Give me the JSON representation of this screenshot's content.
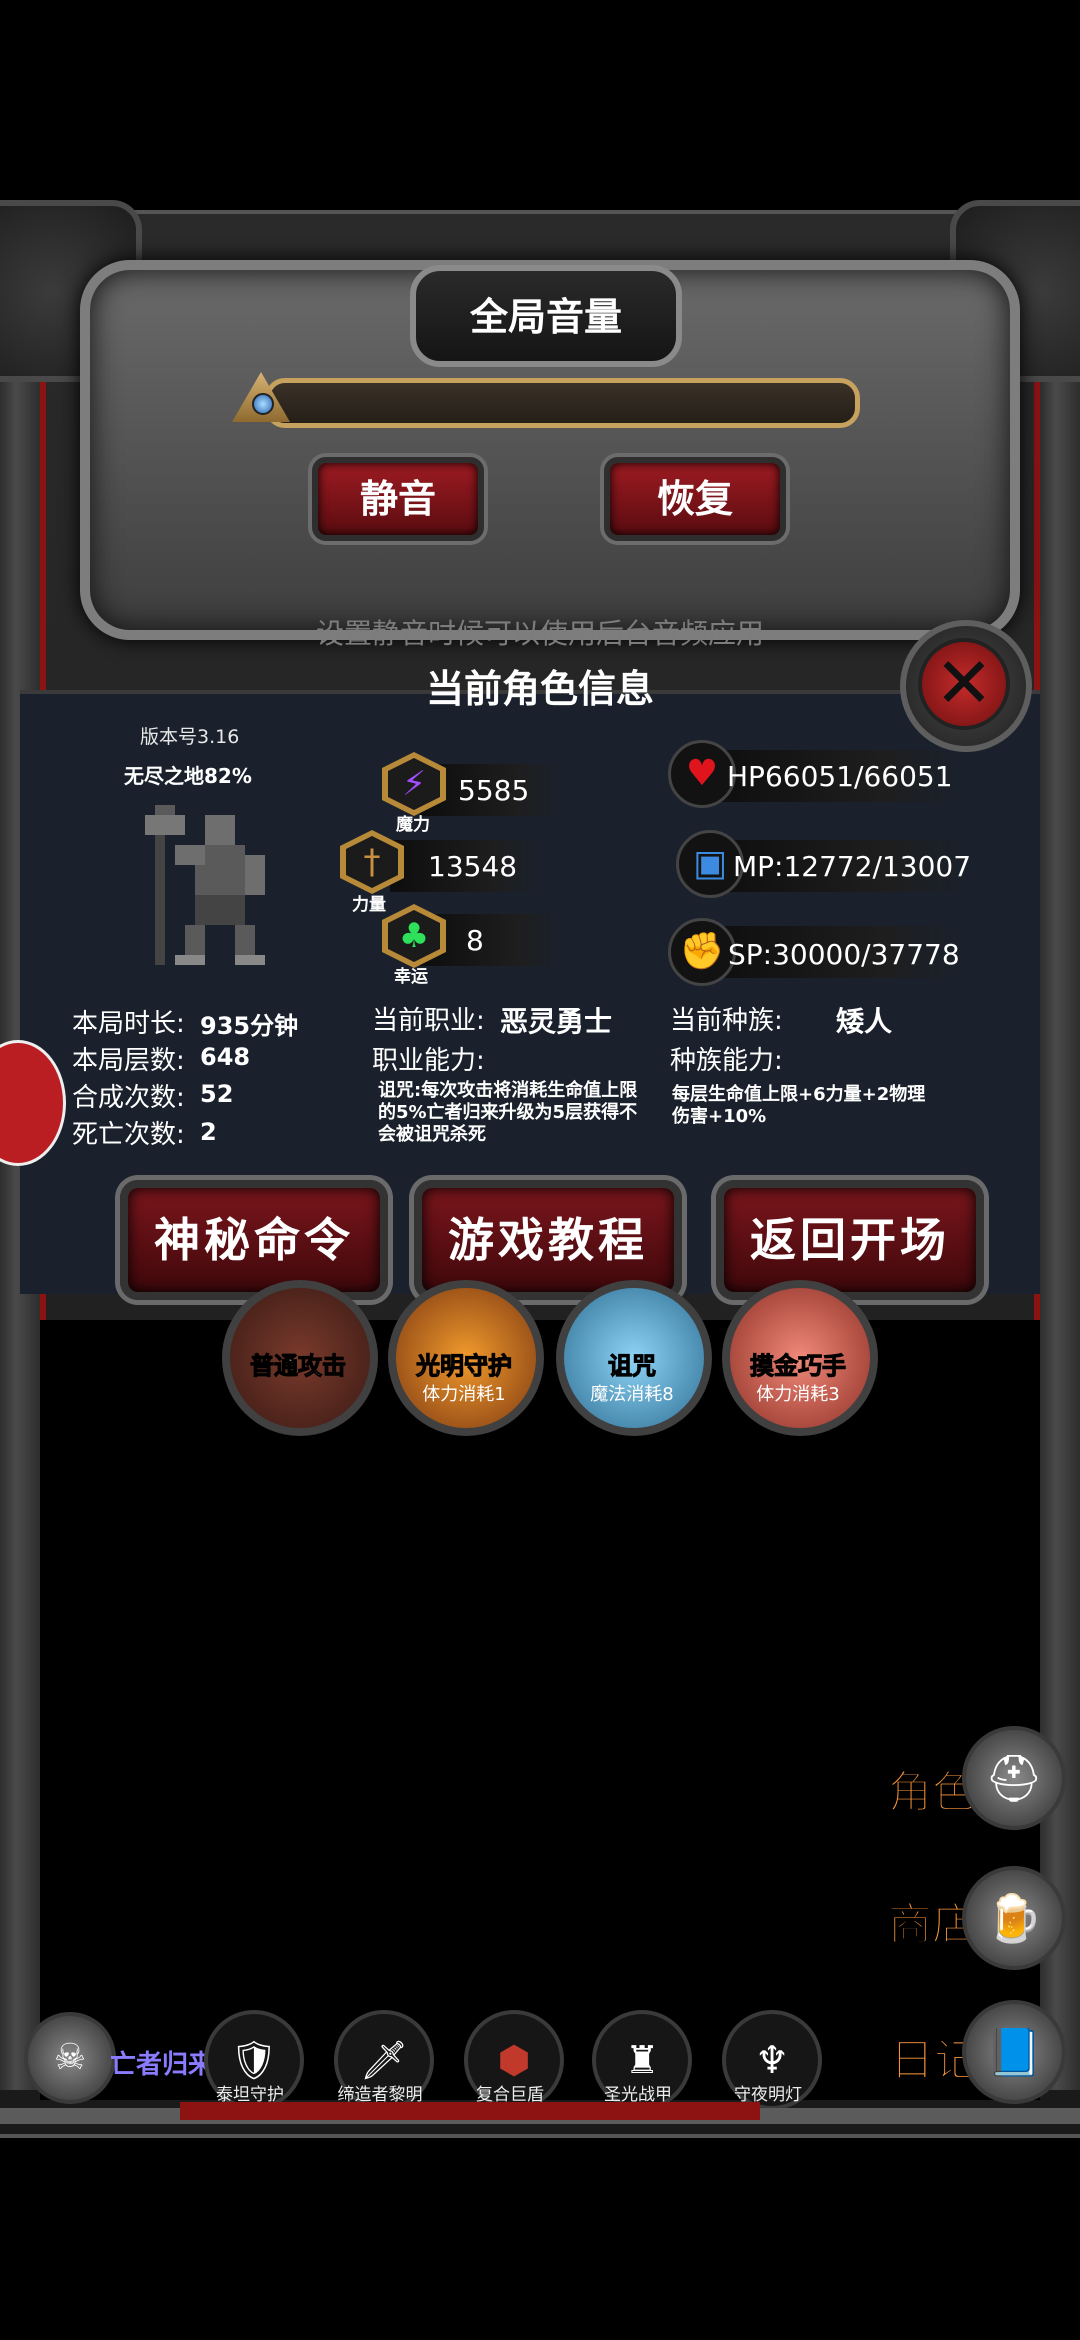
{
  "volume": {
    "title": "全局音量",
    "mute_label": "静音",
    "restore_label": "恢复",
    "hint": "设置静音时候可以使用后台音频应用"
  },
  "info": {
    "title": "当前角色信息",
    "version": "版本号3.16",
    "progress": "无尽之地82%",
    "stats": {
      "magic": {
        "value": "5585",
        "label": "魔力"
      },
      "strength": {
        "value": "13548",
        "label": "力量"
      },
      "luck": {
        "value": "8",
        "label": "幸运"
      }
    },
    "resources": {
      "hp": "HP66051/66051",
      "mp": "MP:12772/13007",
      "sp": "SP:30000/37778"
    },
    "run": {
      "duration_label": "本局时长:",
      "duration_value": "935分钟",
      "floors_label": "本局层数:",
      "floors_value": "648",
      "craft_label": "合成次数:",
      "craft_value": "52",
      "death_label": "死亡次数:",
      "death_value": "2"
    },
    "job": {
      "label": "当前职业:",
      "value": "恶灵勇士",
      "ability_label": "职业能力:",
      "ability_desc": "诅咒:每次攻击将消耗生命值上限的5%亡者归来升级为5层获得不会被诅咒杀死"
    },
    "race": {
      "label": "当前种族:",
      "value": "矮人",
      "ability_label": "种族能力:",
      "ability_desc": "每层生命值上限+6力量+2物理伤害+10%"
    },
    "buttons": {
      "secret": "神秘命令",
      "tutorial": "游戏教程",
      "back": "返回开场"
    }
  },
  "skills": [
    {
      "name": "普通攻击",
      "cost": ""
    },
    {
      "name": "光明守护",
      "cost": "体力消耗1"
    },
    {
      "name": "诅咒",
      "cost": "魔法消耗8"
    },
    {
      "name": "摸金巧手",
      "cost": "体力消耗3"
    }
  ],
  "side_menu": {
    "role": "角色",
    "shop": "商店",
    "diary": "日记"
  },
  "bottom": {
    "player_name": "亡者归来",
    "equipment": [
      "泰坦守护",
      "缔造者黎明",
      "复合巨盾",
      "圣光战甲",
      "守夜明灯"
    ]
  },
  "colors": {
    "accent_red": "#8d1212",
    "menu_orange": "#ff9a3c",
    "panel_bg": "#1a212c"
  }
}
